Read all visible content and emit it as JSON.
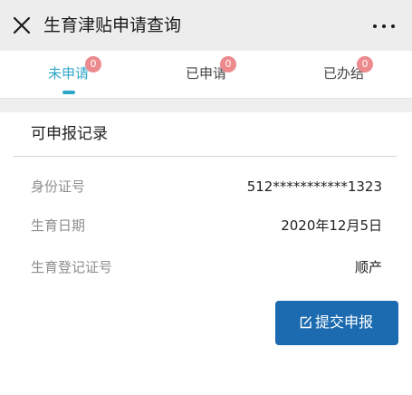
{
  "header": {
    "title": "生育津贴申请查询",
    "close_icon": "close-icon",
    "more_icon": "more-icon"
  },
  "tabs": [
    {
      "label": "未申请",
      "badge": "0",
      "active": true
    },
    {
      "label": "已申请",
      "badge": "0",
      "active": false
    },
    {
      "label": "已办结",
      "badge": "0",
      "active": false
    }
  ],
  "record": {
    "section_title": "可申报记录",
    "rows": [
      {
        "label": "身份证号",
        "value": "512***********1323"
      },
      {
        "label": "生育日期",
        "value": "2020年12月5日"
      },
      {
        "label": "生育登记证号",
        "value": "顺产"
      }
    ],
    "submit_label": "提交申报",
    "submit_icon": "edit-icon"
  },
  "colors": {
    "accent": "#2fa6c7",
    "badge": "#ec8a8e",
    "button": "#1c6bb0"
  }
}
